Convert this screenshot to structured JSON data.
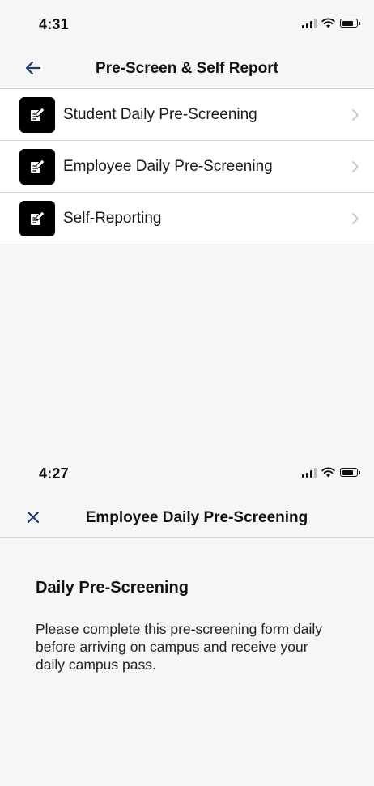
{
  "screen_top": {
    "status": {
      "time": "4:31"
    },
    "nav": {
      "back_icon": "arrow-left-icon",
      "title": "Pre-Screen & Self Report"
    },
    "items": [
      {
        "label": "Student Daily Pre-Screening",
        "icon": "form-edit-icon"
      },
      {
        "label": "Employee Daily Pre-Screening",
        "icon": "form-edit-icon"
      },
      {
        "label": "Self-Reporting",
        "icon": "form-edit-icon"
      }
    ]
  },
  "screen_bottom": {
    "status": {
      "time": "4:27"
    },
    "nav": {
      "close_icon": "close-icon",
      "title": "Employee Daily Pre-Screening"
    },
    "content": {
      "heading": "Daily Pre-Screening",
      "body": "Please complete this pre-screening form daily before arriving on campus and receive your daily campus pass."
    }
  },
  "colors": {
    "accent": "#1f3a6e",
    "background": "#f6f6f6",
    "list_background": "#ffffff",
    "divider": "#d9d9d9",
    "chevron": "#c4c4c4"
  }
}
